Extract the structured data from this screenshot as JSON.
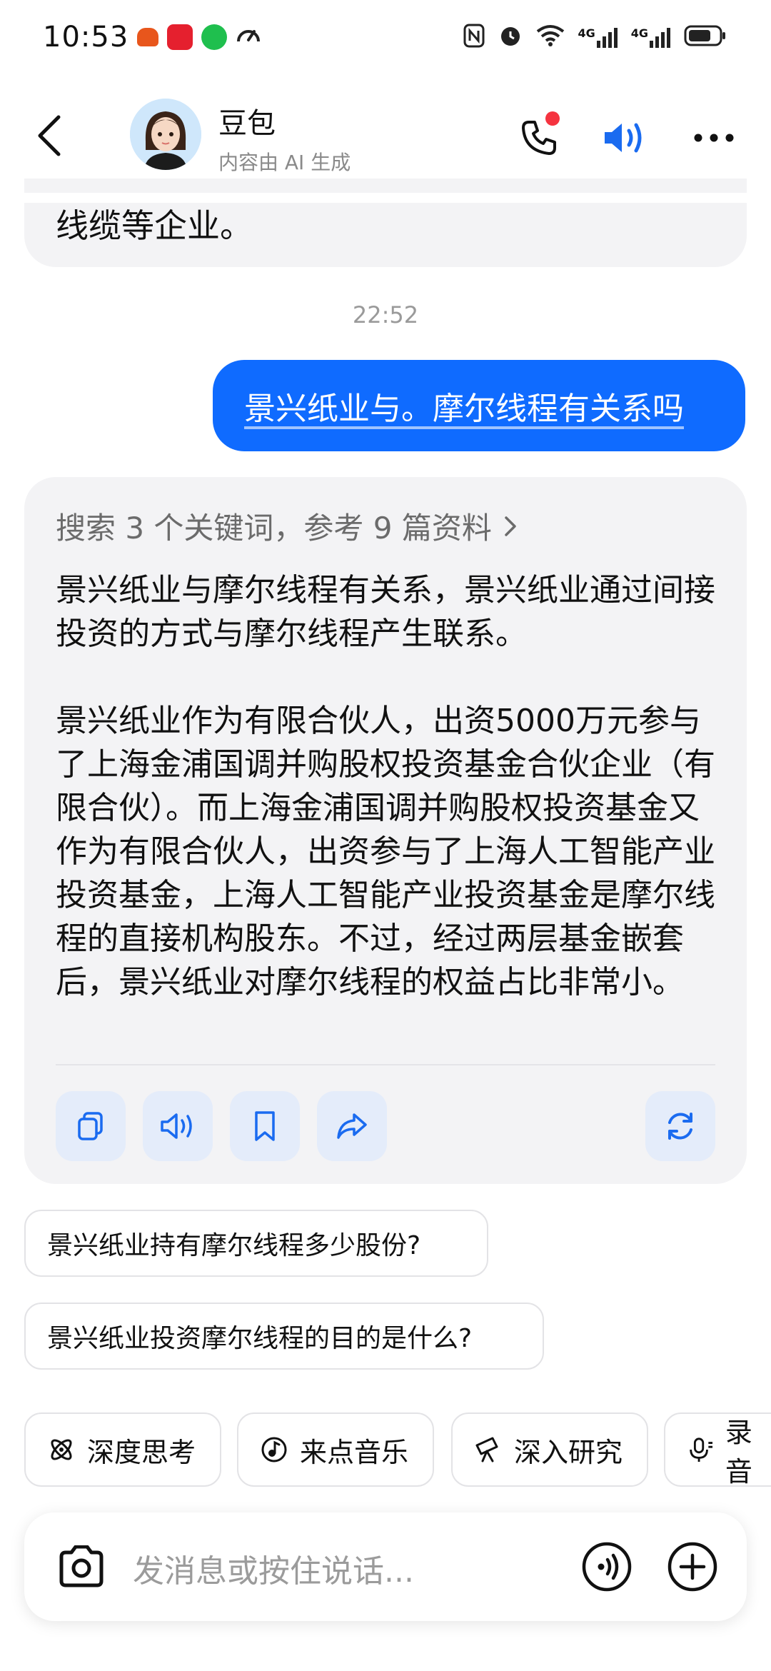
{
  "status_bar": {
    "time": "10:53",
    "network_1": "4G",
    "network_2": "4G"
  },
  "header": {
    "bot_name": "豆包",
    "subtitle": "内容由 AI 生成"
  },
  "chat": {
    "previous_tail": "线缆等企业。",
    "timestamp": "22:52",
    "user_message": "景兴纸业与。摩尔线程有关系吗",
    "search_summary": "搜索 3 个关键词，参考 9 篇资料",
    "answer_paragraphs": [
      "景兴纸业与摩尔线程有关系，景兴纸业通过间接投资的方式与摩尔线程产生联系。",
      "景兴纸业作为有限合伙人，出资5000万元参与了上海金浦国调并购股权投资基金合伙企业（有限合伙）。而上海金浦国调并购股权投资基金又作为有限合伙人，出资参与了上海人工智能产业投资基金，上海人工智能产业投资基金是摩尔线程的直接机构股东。不过，经过两层基金嵌套后，景兴纸业对摩尔线程的权益占比非常小。"
    ]
  },
  "suggestions": [
    "景兴纸业持有摩尔线程多少股份?",
    "景兴纸业投资摩尔线程的目的是什么?"
  ],
  "chips": [
    {
      "label": "深度思考",
      "icon": "atom-icon"
    },
    {
      "label": "来点音乐",
      "icon": "music-icon"
    },
    {
      "label": "深入研究",
      "icon": "telescope-icon"
    },
    {
      "label": "录音",
      "icon": "mic-icon"
    }
  ],
  "input": {
    "placeholder": "发消息或按住说话..."
  },
  "colors": {
    "accent": "#0f6bff",
    "bubble_bg": "#f3f3f5",
    "action_bg": "#e4ecfa"
  }
}
